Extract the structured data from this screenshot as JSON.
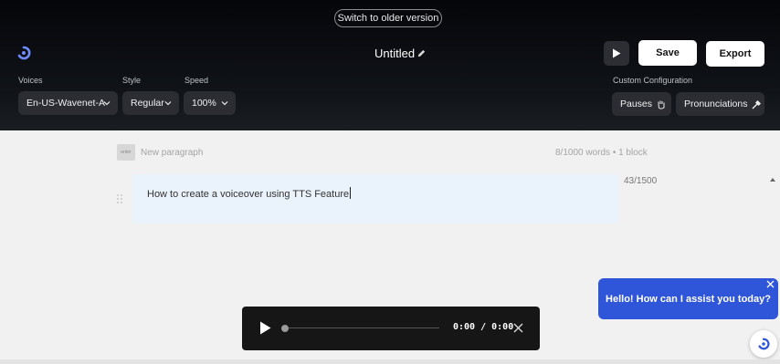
{
  "header": {
    "old_version_label": "Switch to older version",
    "title": "Untitled",
    "save_label": "Save",
    "export_label": "Export"
  },
  "voices": {
    "label": "Voices",
    "value": "En-US-Wavenet-A"
  },
  "style": {
    "label": "Style",
    "value": "Regular"
  },
  "speed": {
    "label": "Speed",
    "value": "100%"
  },
  "custom_config": {
    "label": "Custom Configuration",
    "pauses_label": "Pauses",
    "pronunciations_label": "Pronunciations"
  },
  "editor": {
    "enter_badge": "enter",
    "new_paragraph_label": "New paragraph",
    "word_count": "8/1000 words  •  1 block",
    "paragraph_text": "How to create a voiceover using TTS Feature",
    "char_count": "43/1500"
  },
  "player": {
    "time": "0:00 / 0:00",
    "progress": 0
  },
  "chat": {
    "message": "Hello! How can I assist you today?"
  },
  "colors": {
    "accent": "#2f56d8",
    "header_bg": "#0b0d11",
    "editor_bg": "#f1f1f1",
    "paragraph_bg": "#eaf2fb"
  },
  "icons": [
    "logo-icon",
    "pencil-icon",
    "play-icon",
    "chevron-down-icon",
    "hand-icon",
    "wand-icon",
    "drag-handle-icon",
    "close-icon",
    "chat-logo-icon"
  ]
}
